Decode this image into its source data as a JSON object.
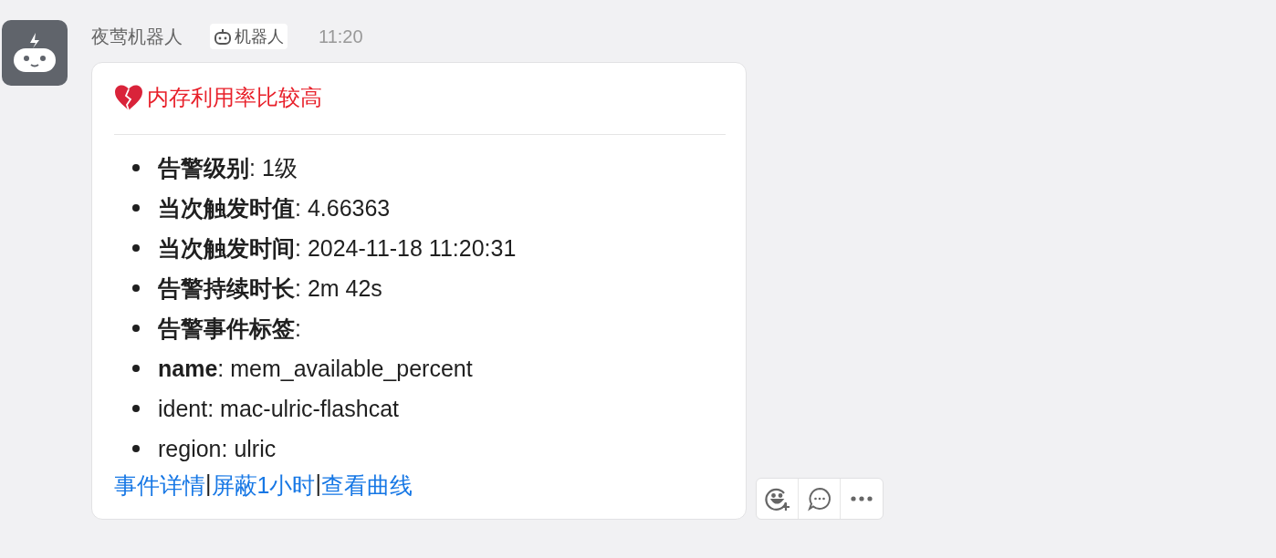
{
  "sender": {
    "name": "夜莺机器人",
    "badge": "机器人",
    "time": "11:20"
  },
  "card": {
    "title": "内存利用率比较高",
    "items": [
      {
        "text": "**告警级别**: 1级"
      },
      {
        "text": "**当次触发时值**: 4.66363"
      },
      {
        "text": "**当次触发时间**: 2024-11-18 11:20:31"
      },
      {
        "text": "**告警持续时长**: 2m 42s"
      },
      {
        "text": "**告警事件标签**:"
      },
      {
        "text": "**name**: mem_available_percent"
      },
      {
        "text": "ident: mac-ulric-flashcat"
      },
      {
        "text": "region: ulric"
      }
    ],
    "links": [
      "事件详情",
      "屏蔽1小时",
      "查看曲线"
    ],
    "separator": "|"
  },
  "actions": [
    {
      "kind": "emoji"
    },
    {
      "kind": "reply"
    },
    {
      "kind": "more"
    }
  ]
}
